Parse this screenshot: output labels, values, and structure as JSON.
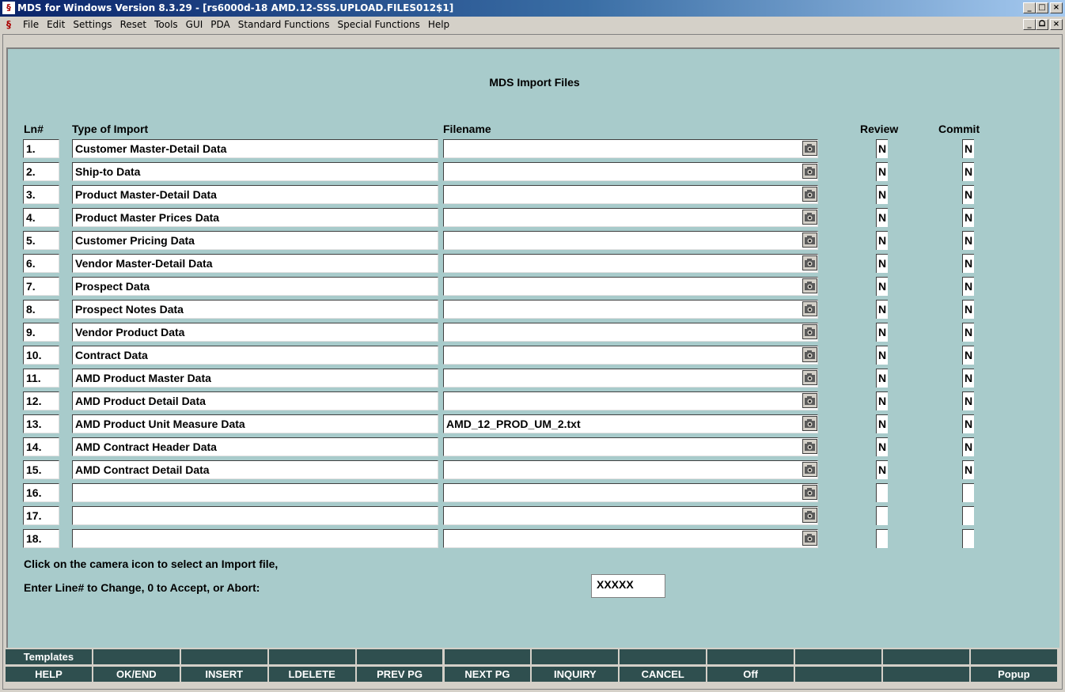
{
  "window": {
    "app_icon_text": "§",
    "title": "MDS for Windows Version 8.3.29 - [rs6000d-18 AMD.12-SSS.UPLOAD.FILES012$1]",
    "min": "_",
    "max": "□",
    "restore": "ᗝ",
    "close": "×"
  },
  "menu": {
    "items": [
      "File",
      "Edit",
      "Settings",
      "Reset",
      "Tools",
      "GUI",
      "PDA",
      "Standard Functions",
      "Special Functions",
      "Help"
    ]
  },
  "screen": {
    "title": "MDS Import Files",
    "headers": {
      "ln": "Ln#",
      "type": "Type of Import",
      "filename": "Filename",
      "review": "Review",
      "commit": "Commit"
    }
  },
  "rows": [
    {
      "ln": "1.",
      "type": "Customer Master-Detail Data",
      "filename": "",
      "review": "N",
      "commit": "N"
    },
    {
      "ln": "2.",
      "type": "Ship-to Data",
      "filename": "",
      "review": "N",
      "commit": "N"
    },
    {
      "ln": "3.",
      "type": "Product Master-Detail Data",
      "filename": "",
      "review": "N",
      "commit": "N"
    },
    {
      "ln": "4.",
      "type": "Product Master Prices Data",
      "filename": "",
      "review": "N",
      "commit": "N"
    },
    {
      "ln": "5.",
      "type": "Customer Pricing Data",
      "filename": "",
      "review": "N",
      "commit": "N"
    },
    {
      "ln": "6.",
      "type": "Vendor Master-Detail Data",
      "filename": "",
      "review": "N",
      "commit": "N"
    },
    {
      "ln": "7.",
      "type": "Prospect Data",
      "filename": "",
      "review": "N",
      "commit": "N"
    },
    {
      "ln": "8.",
      "type": "Prospect Notes Data",
      "filename": "",
      "review": "N",
      "commit": "N"
    },
    {
      "ln": "9.",
      "type": "Vendor Product Data",
      "filename": "",
      "review": "N",
      "commit": "N"
    },
    {
      "ln": "10.",
      "type": "Contract Data",
      "filename": "",
      "review": "N",
      "commit": "N"
    },
    {
      "ln": "11.",
      "type": "AMD Product Master Data",
      "filename": "",
      "review": "N",
      "commit": "N"
    },
    {
      "ln": "12.",
      "type": "AMD Product Detail Data",
      "filename": "",
      "review": "N",
      "commit": "N"
    },
    {
      "ln": "13.",
      "type": "AMD Product Unit Measure Data",
      "filename": "AMD_12_PROD_UM_2.txt",
      "review": "N",
      "commit": "N"
    },
    {
      "ln": "14.",
      "type": "AMD Contract Header Data",
      "filename": "",
      "review": "N",
      "commit": "N"
    },
    {
      "ln": "15.",
      "type": "AMD Contract Detail Data",
      "filename": "",
      "review": "N",
      "commit": "N"
    },
    {
      "ln": "16.",
      "type": "",
      "filename": "",
      "review": "",
      "commit": ""
    },
    {
      "ln": "17.",
      "type": "",
      "filename": "",
      "review": "",
      "commit": ""
    },
    {
      "ln": "18.",
      "type": "",
      "filename": "",
      "review": "",
      "commit": ""
    }
  ],
  "prompts": {
    "line1": "Click on the camera icon to select an Import file,",
    "line2": "Enter Line# to Change, 0 to Accept, or Abort:",
    "answer": "XXXXX"
  },
  "fkeys": {
    "top": [
      "Templates",
      "",
      "",
      "",
      "",
      "",
      "",
      "",
      "",
      "",
      "",
      ""
    ],
    "bottom": [
      "HELP",
      "OK/END",
      "INSERT",
      "LDELETE",
      "PREV PG",
      "NEXT PG",
      "INQUIRY",
      "CANCEL",
      "Off",
      "",
      "",
      "Popup"
    ]
  }
}
